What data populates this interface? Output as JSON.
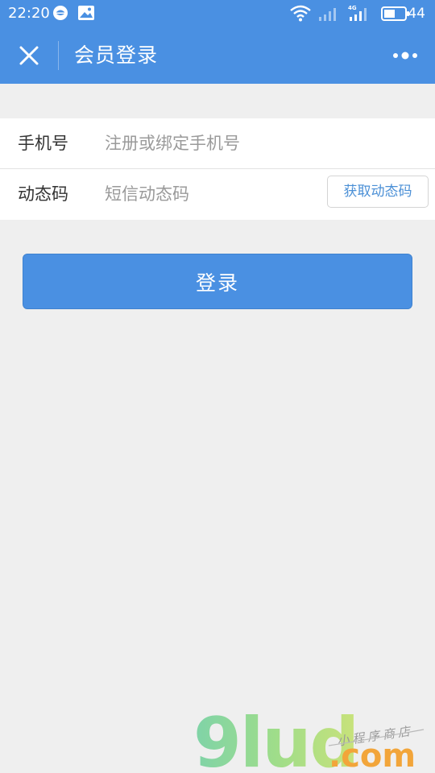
{
  "status_bar": {
    "time": "22:20",
    "battery": "44",
    "icons": [
      "message-icon",
      "gallery-icon",
      "wifi-icon",
      "signal-icon",
      "signal-4g-icon",
      "battery-icon"
    ]
  },
  "nav": {
    "title": "会员登录",
    "close_icon": "close-icon",
    "more_icon": "more-icon"
  },
  "form": {
    "phone_label": "手机号",
    "phone_placeholder": "注册或绑定手机号",
    "phone_value": "",
    "code_label": "动态码",
    "code_placeholder": "短信动态码",
    "code_value": "",
    "get_code_label": "获取动态码"
  },
  "login_label": "登录",
  "watermark": {
    "brand": "9lud",
    "domain": ".com",
    "tagline": "小程序商店"
  },
  "colors": {
    "accent": "#4a90e2",
    "background": "#efefef",
    "link": "#4a8fd6"
  }
}
